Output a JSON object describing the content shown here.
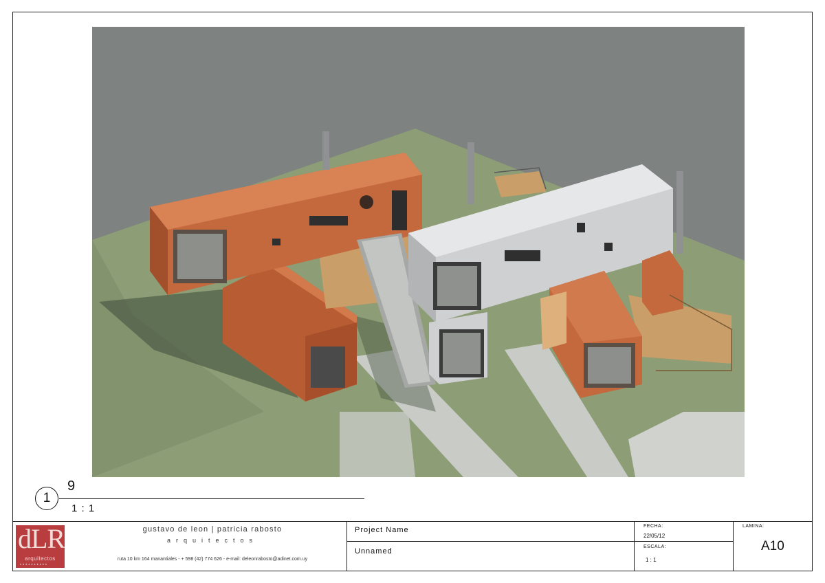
{
  "view": {
    "number": "1",
    "name": "9",
    "scale": "1 : 1"
  },
  "titleblock": {
    "logo_letters": "dLR",
    "logo_sub": "arquitectos",
    "firm_names": "gustavo de leon | patricia rabosto",
    "firm_subtitle": "arquitectos",
    "firm_contact": "ruta 10 km 164 manantiales - + 598 (42) 774 626 - e-mail: deleonrabosto@adinet.com.uy",
    "project_label": "Project Name",
    "project_sub": "Unnamed",
    "fecha_label": "FECHA:",
    "fecha_value": "22/05/12",
    "escala_label": "ESCALA:",
    "escala_value": "1 : 1",
    "lamina_label": "LAMINA:",
    "lamina_value": "A10"
  },
  "colors": {
    "logo_bg": "#b93c3f",
    "render_sky": "#7e8281",
    "container_orange": "#c4683d",
    "container_grey": "#cfd0d1",
    "grass": "#8d9d76",
    "deck": "#c99e68"
  }
}
